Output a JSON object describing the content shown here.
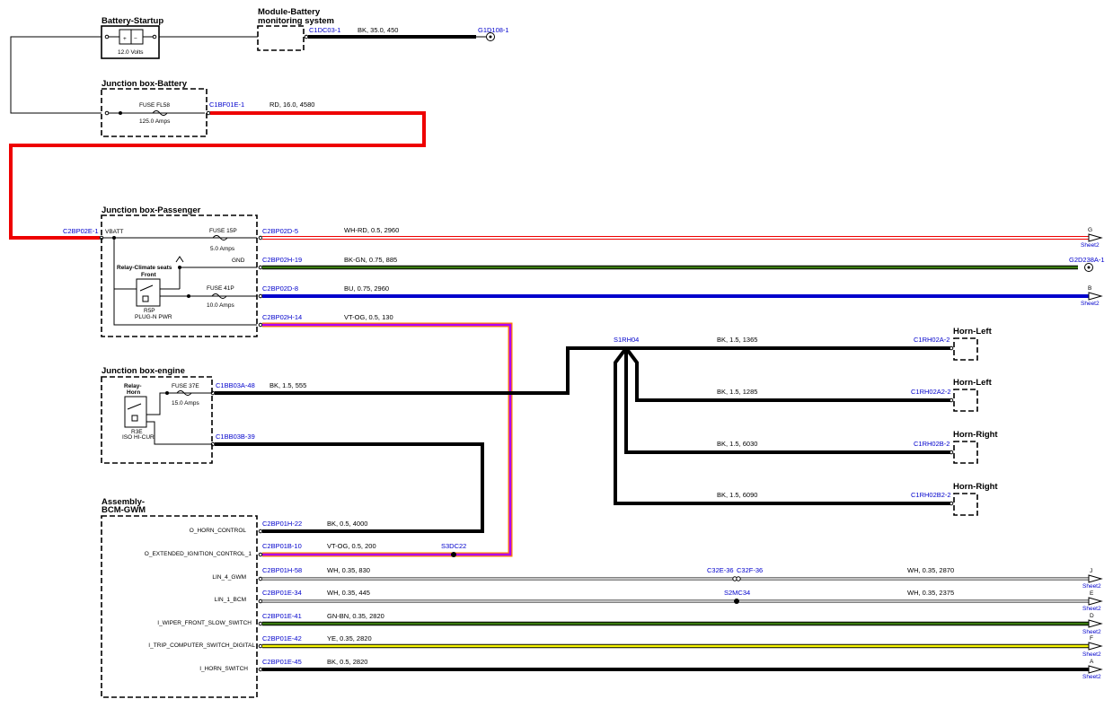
{
  "components": {
    "battery": {
      "title": "Battery-Startup",
      "volts": "12.0 Volts"
    },
    "bms": {
      "title_l1": "Module-Battery",
      "title_l2": "monitoring system"
    },
    "jb_battery": {
      "title": "Junction box-Battery",
      "fuse": "FUSE FL58",
      "amps": "125.0 Amps"
    },
    "jb_passenger": {
      "title": "Junction box-Passenger",
      "vbatt": "VBATT",
      "gnd": "GND",
      "fuse1": "FUSE 15P",
      "fuse1_amps": "5.0 Amps",
      "relay_l1": "Relay-Climate seats",
      "relay_l2": "Front",
      "fuse2": "FUSE 41P",
      "fuse2_amps": "10.0 Amps",
      "relay_code": "R5P",
      "relay_type": "PLUG-N PWR"
    },
    "jb_engine": {
      "title": "Junction box-engine",
      "relay_l1": "Relay-",
      "relay_l2": "Horn",
      "fuse": "FUSE 37E",
      "amps": "15.0 Amps",
      "relay_code": "R3E",
      "relay_type": "ISO HI-CUR"
    },
    "bcm": {
      "title_l1": "Assembly-",
      "title_l2": "BCM-GWM",
      "pins": [
        "O_HORN_CONTROL",
        "O_EXTENDED_IGNITION_CONTROL_1",
        "LIN_4_GWM",
        "LIN_1_BCM",
        "I_WIPER_FRONT_SLOW_SWITCH",
        "I_TRIP_COMPUTER_SWITCH_DIGITAL",
        "I_HORN_SWITCH"
      ]
    },
    "horns": [
      "Horn-Left",
      "Horn-Left",
      "Horn-Right",
      "Horn-Right"
    ]
  },
  "connectors": {
    "bms_c": "C1DC03-1",
    "ground1": "G1D108-1",
    "jbb_c": "C1BF01E-1",
    "jbp_in": "C2BP02E-1",
    "jbp_c1": "C2BP02D-5",
    "jbp_c2": "C2BP02H-19",
    "jbp_c3": "C2BP02D-8",
    "jbp_c4": "C2BP02H-14",
    "ground2": "G2D238A-1",
    "jbe_c1": "C1BB03A-48",
    "jbe_c2": "C1BB03B-39",
    "splice_horn": "S1RH04",
    "horn_c": [
      "C1RH02A-2",
      "C1RH02A2-2",
      "C1RH02B-2",
      "C1RH02B2-2"
    ],
    "bcm_c": [
      "C2BP01H-22",
      "C2BP01B-10",
      "C2BP01H-58",
      "C2BP01E-34",
      "C2BP01E-41",
      "C2BP01E-42",
      "C2BP01E-45"
    ],
    "splice_s3dc22": "S3DC22",
    "inline_a": "C32E-36",
    "inline_b": "C32F-36",
    "splice_s2mc34": "S2MC34"
  },
  "wires": {
    "bms_gnd": "BK,  35.0,  450",
    "bat_feed": "RD,  16.0,  4580",
    "p1": "WH-RD,  0.5,  2960",
    "p2": "BK-GN,  0.75,  885",
    "p3": "BU,  0.75,  2960",
    "p4": "VT-OG,  0.5,  130",
    "horn_relay": "BK,  1.5,  555",
    "horn_left1": "BK,  1.5,  1365",
    "horn_left2": "BK,  1.5,  1285",
    "horn_right1": "BK,  1.5,  6030",
    "horn_right2": "BK,  1.5,  6090",
    "b1": "BK,  0.5,  4000",
    "b2": "VT-OG,  0.5,  200",
    "b3": "WH,  0.35,  830",
    "b3b": "WH,  0.35,  2870",
    "b4": "WH,  0.35,  445",
    "b4b": "WH,  0.35,  2375",
    "b5": "GN-BN,  0.35,  2820",
    "b6": "YE,  0.35,  2820",
    "b7": "BK,  0.5,  2820"
  },
  "sheet_refs": {
    "p1": "G",
    "p3": "B",
    "b3": "J",
    "b4": "E",
    "b5": "D",
    "b6": "F",
    "b7": "A",
    "sheet": "Sheet2"
  },
  "colors": {
    "red": "#ee0000",
    "blue": "#0000cc",
    "green": "#3a7a10",
    "yellow": "#f5f500",
    "violet": "#b000ff",
    "orange": "#ff8000",
    "connector_text": "#0000cc"
  }
}
